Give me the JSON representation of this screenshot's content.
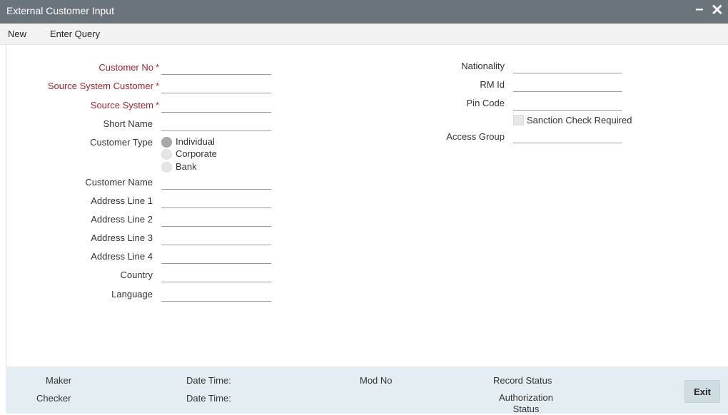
{
  "window": {
    "title": "External Customer Input",
    "minimize_glyph": "−",
    "close_glyph": "✕"
  },
  "menu": {
    "new_label": "New",
    "enter_query_label": "Enter Query"
  },
  "form": {
    "customer_no": {
      "label": "Customer No",
      "required_mark": "*",
      "value": ""
    },
    "source_system_customer": {
      "label": "Source System Customer",
      "required_mark": "*",
      "value": ""
    },
    "source_system": {
      "label": "Source System",
      "required_mark": "*",
      "value": ""
    },
    "short_name": {
      "label": "Short Name",
      "value": ""
    },
    "customer_type": {
      "label": "Customer Type",
      "options": [
        "Individual",
        "Corporate",
        "Bank"
      ],
      "selected": "Individual"
    },
    "customer_name": {
      "label": "Customer Name",
      "value": ""
    },
    "address_line_1": {
      "label": "Address Line 1",
      "value": ""
    },
    "address_line_2": {
      "label": "Address Line 2",
      "value": ""
    },
    "address_line_3": {
      "label": "Address Line 3",
      "value": ""
    },
    "address_line_4": {
      "label": "Address Line 4",
      "value": ""
    },
    "country": {
      "label": "Country",
      "value": ""
    },
    "language": {
      "label": "Language",
      "value": ""
    },
    "nationality": {
      "label": "Nationality",
      "value": ""
    },
    "rm_id": {
      "label": "RM Id",
      "value": ""
    },
    "pin_code": {
      "label": "Pin Code",
      "value": ""
    },
    "sanction_check": {
      "label": "Sanction Check Required",
      "checked": false
    },
    "access_group": {
      "label": "Access Group",
      "value": ""
    }
  },
  "footer": {
    "maker_label": "Maker",
    "checker_label": "Checker",
    "maker_date_time_label": "Date Time:",
    "checker_date_time_label": "Date Time:",
    "mod_no_label": "Mod No",
    "record_status_label": "Record Status",
    "authorization_status_line1": "Authorization",
    "authorization_status_line2": "Status",
    "exit_label": "Exit"
  },
  "colors": {
    "titlebar_bg": "#6b737b",
    "required_label": "#a8222c",
    "footer_bg": "#e4edf1"
  }
}
